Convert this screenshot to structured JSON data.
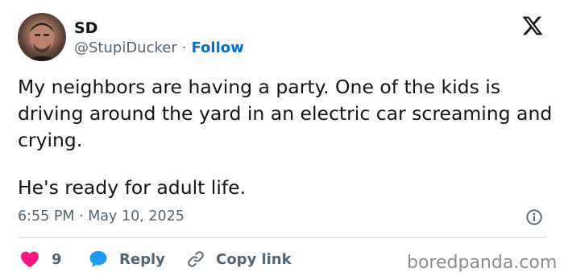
{
  "author": {
    "display_name": "SD",
    "handle": "@StupiDucker",
    "separator": "·",
    "follow_label": "Follow"
  },
  "tweet": {
    "paragraph_1": "My neighbors are having a party. One of the kids is driving around the yard in an electric car screaming and crying.",
    "paragraph_2": "He's ready for adult life.",
    "timestamp": "6:55 PM · May 10, 2025"
  },
  "actions": {
    "like_count": "9",
    "reply_label": "Reply",
    "copy_link_label": "Copy link"
  },
  "watermark": "boredpanda.com",
  "colors": {
    "text": "#0f1419",
    "secondary": "#536471",
    "accent": "#006fd6",
    "like": "#f91880",
    "reply": "#1d9bf0",
    "divider": "#cfd9de"
  },
  "icons": {
    "brand": "x-logo-icon",
    "info": "info-icon",
    "like": "heart-icon",
    "reply": "speech-bubble-icon",
    "copy": "link-icon"
  }
}
